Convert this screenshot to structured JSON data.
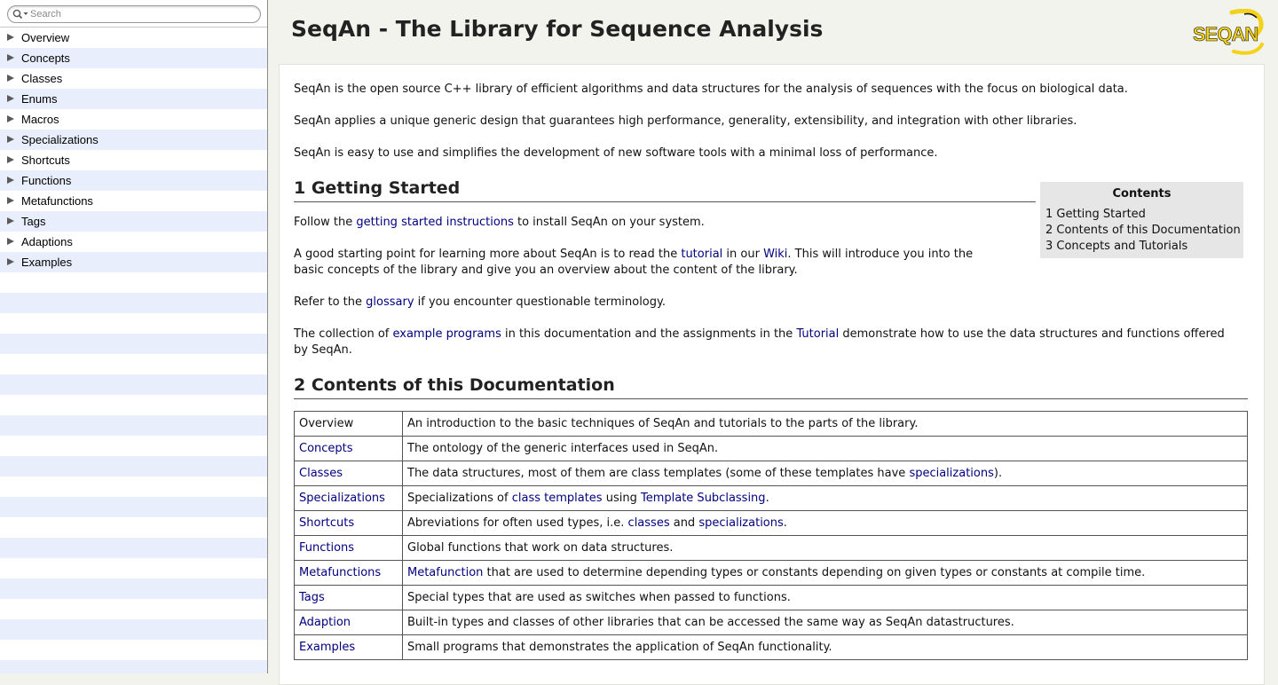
{
  "sidebar": {
    "search_placeholder": "Search",
    "items": [
      {
        "label": "Overview"
      },
      {
        "label": "Concepts"
      },
      {
        "label": "Classes"
      },
      {
        "label": "Enums"
      },
      {
        "label": "Macros"
      },
      {
        "label": "Specializations"
      },
      {
        "label": "Shortcuts"
      },
      {
        "label": "Functions"
      },
      {
        "label": "Metafunctions"
      },
      {
        "label": "Tags"
      },
      {
        "label": "Adaptions"
      },
      {
        "label": "Examples"
      }
    ],
    "empty_rows": 20
  },
  "header": {
    "title": "SeqAn - The Library for Sequence Analysis",
    "logo_text": "SEQAN",
    "logo_colors": {
      "primary": "#f2d21a",
      "secondary": "#111111"
    }
  },
  "content": {
    "intro": [
      "SeqAn is the open source C++ library of efficient algorithms and data structures for the analysis of sequences with the focus on biological data.",
      "SeqAn applies a unique generic design that guarantees high performance, generality, extensibility, and integration with other libraries.",
      "SeqAn is easy to use and simplifies the development of new software tools with a minimal loss of performance."
    ],
    "section1": {
      "heading": "1 Getting Started",
      "p1": {
        "a": "Follow the ",
        "link1": "getting started instructions",
        "b": " to install SeqAn on your system."
      },
      "p2": {
        "a": "A good starting point for learning more about SeqAn is to read the ",
        "link1": "tutorial",
        "b": " in our ",
        "link2": "Wiki",
        "c": ". This will introduce you into the basic concepts of the library and give you an overview about the content of the library."
      },
      "p3": {
        "a": "Refer to the ",
        "link1": "glossary",
        "b": " if you encounter questionable terminology."
      },
      "p4": {
        "a": "The collection of ",
        "link1": "example programs",
        "b": " in this documentation and the assignments in the ",
        "link2": "Tutorial",
        "c": " demonstrate how to use the data structures and functions offered by SeqAn."
      }
    },
    "toc": {
      "title": "Contents",
      "items": [
        "1 Getting Started",
        "2 Contents of this Documentation",
        "3 Concepts and Tutorials"
      ]
    },
    "section2": {
      "heading": "2 Contents of this Documentation",
      "rows": [
        {
          "key": "Overview",
          "desc": "An introduction to the basic techniques of SeqAn and tutorials to the parts of the library."
        },
        {
          "key": "Concepts",
          "desc": "The ontology of the generic interfaces used in SeqAn."
        },
        {
          "key": "Classes",
          "desc_a": "The data structures, most of them are class templates (some of these templates have ",
          "desc_link1": "specializations",
          "desc_b": ")."
        },
        {
          "key": "Specializations",
          "desc_a": "Specializations of ",
          "desc_link1": "class templates",
          "desc_b": " using ",
          "desc_link2": "Template Subclassing",
          "desc_c": "."
        },
        {
          "key": "Shortcuts",
          "desc_a": "Abreviations for often used types, i.e. ",
          "desc_link1": "classes",
          "desc_b": " and ",
          "desc_link2": "specializations",
          "desc_c": "."
        },
        {
          "key": "Functions",
          "desc": "Global functions that work on data structures."
        },
        {
          "key": "Metafunctions",
          "desc_link1": "Metafunction",
          "desc_b": " that are used to determine depending types or constants depending on given types or constants at compile time."
        },
        {
          "key": "Tags",
          "desc": "Special types that are used as switches when passed to functions."
        },
        {
          "key": "Adaption",
          "desc": "Built-in types and classes of other libraries that can be accessed the same way as SeqAn datastructures."
        },
        {
          "key": "Examples",
          "desc": "Small programs that demonstrates the application of SeqAn functionality."
        }
      ]
    }
  }
}
